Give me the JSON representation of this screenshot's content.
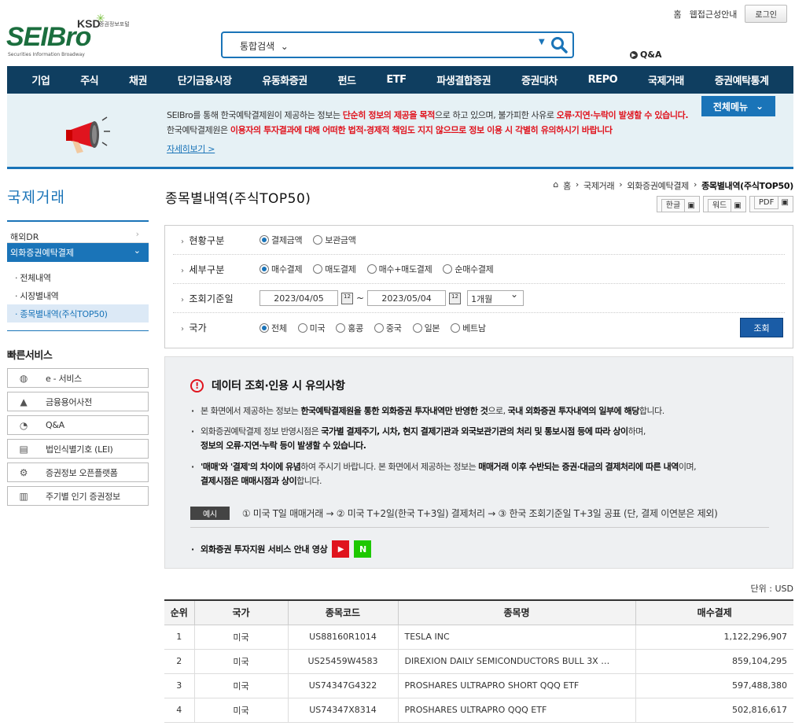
{
  "logo": {
    "brand": "SEIBro",
    "ksd": "KSD",
    "ksd_sub": "증권정보포털",
    "tagline": "Securities Information Broadway"
  },
  "top_links": {
    "home": "홈",
    "accessibility": "웹접근성안내",
    "login": "로그인"
  },
  "search": {
    "scope": "통합검색",
    "icon": "search-icon"
  },
  "qa_link": "Q&A",
  "gnb": [
    "기업",
    "주식",
    "채권",
    "단기금융시장",
    "유동화증권",
    "펀드",
    "ETF",
    "파생결합증권",
    "증권대차",
    "REPO",
    "국제거래",
    "증권예탁통계"
  ],
  "notice": {
    "line1_a": "SEIBro를 통해 한국예탁결제원이 제공하는 정보는 ",
    "line1_red1": "단순히 정보의 제공을 목적",
    "line1_b": "으로 하고 있으며, 불가피한 사유로 ",
    "line1_red2": "오류·지연·누락이 발생할 수 있습니다.",
    "line2_a": "한국예탁결제원은 ",
    "line2_red": "이용자의 투자결과에 대해 어떠한 법적·경제적 책임도 지지 않으므로 정보 이용 시 각별히 유의하시기 바랍니다",
    "more": "자세히보기 >",
    "all_menu": "전체메뉴"
  },
  "lnb": {
    "title": "국제거래",
    "item1": "해외DR",
    "item2": "외화증권예탁결제",
    "subs": [
      "전체내역",
      "시장별내역",
      "종목별내역(주식TOP50)"
    ]
  },
  "quick": {
    "title": "빠른서비스",
    "items": [
      "e - 서비스",
      "금융용어사전",
      "Q&A",
      "법인식별기호 (LEI)",
      "증권정보 오픈플랫폼",
      "주기별 인기 증권정보"
    ]
  },
  "breadcrumb": {
    "home": "홈",
    "c1": "국제거래",
    "c2": "외화증권예탁결제",
    "c3": "종목별내역(주식TOP50)"
  },
  "page_title": "종목별내역(주식TOP50)",
  "downloads": {
    "hangul": "한글",
    "word": "워드",
    "pdf": "PDF"
  },
  "filter": {
    "status_label": "현황구분",
    "status_opts": [
      "결제금액",
      "보관금액"
    ],
    "detail_label": "세부구분",
    "detail_opts": [
      "매수결제",
      "매도결제",
      "매수+매도결제",
      "순매수결제"
    ],
    "date_label": "조회기준일",
    "date_from": "2023/04/05",
    "date_sep": "~",
    "date_to": "2023/05/04",
    "period": "1개월",
    "country_label": "국가",
    "country_opts": [
      "전체",
      "미국",
      "홍콩",
      "중국",
      "일본",
      "베트남"
    ],
    "search_btn": "조회"
  },
  "caution": {
    "title": "데이터 조회·인용 시 유의사항",
    "b1_a": "본 화면에서 제공하는 정보는 ",
    "b1_b": "한국예탁결제원을 통한 외화증권 투자내역만 반영한 것",
    "b1_c": "으로, ",
    "b1_d": "국내 외화증권 투자내역의 일부에 해당",
    "b1_e": "합니다.",
    "b2_a": "외화증권예탁결제 정보 반영시점은 ",
    "b2_b": "국가별 결제주기, 시차, 현지 결제기관과 외국보관기관의 처리 및 통보시점 등에 따라 상이",
    "b2_c": "하며,",
    "b2_d": "정보의 오류·지연·누락 등이 발생할 수 있습니다.",
    "b3_a": "'매매'와 '결제'의 차이에 유념",
    "b3_b": "하여 주시기 바랍니다. 본 화면에서 제공하는 정보는 ",
    "b3_c": "매매거래 이후 수반되는 증권·대금의 결제처리에 따른 내역",
    "b3_d": "이며,",
    "b3_e": "결제시점은 매매시점과 상이",
    "b3_f": "합니다.",
    "example_tag": "예시",
    "example": "① 미국 T일 매매거래 → ② 미국 T+2일(한국 T+3일) 결제처리 → ③ 한국 조회기준일 T+3일 공표 (단, 결제 이연분은 제외)",
    "video": "외화증권 투자지원 서비스 안내 영상"
  },
  "unit": "단위 : USD",
  "table": {
    "headers": [
      "순위",
      "국가",
      "종목코드",
      "종목명",
      "매수결제"
    ],
    "rows": [
      [
        "1",
        "미국",
        "US88160R1014",
        "TESLA INC",
        "1,122,296,907"
      ],
      [
        "2",
        "미국",
        "US25459W4583",
        "DIREXION DAILY SEMICONDUCTORS BULL 3X …",
        "859,104,295"
      ],
      [
        "3",
        "미국",
        "US74347G4322",
        "PROSHARES ULTRAPRO SHORT QQQ ETF",
        "597,488,380"
      ],
      [
        "4",
        "미국",
        "US74347X8314",
        "PROSHARES ULTRAPRO QQQ ETF",
        "502,816,617"
      ]
    ]
  }
}
